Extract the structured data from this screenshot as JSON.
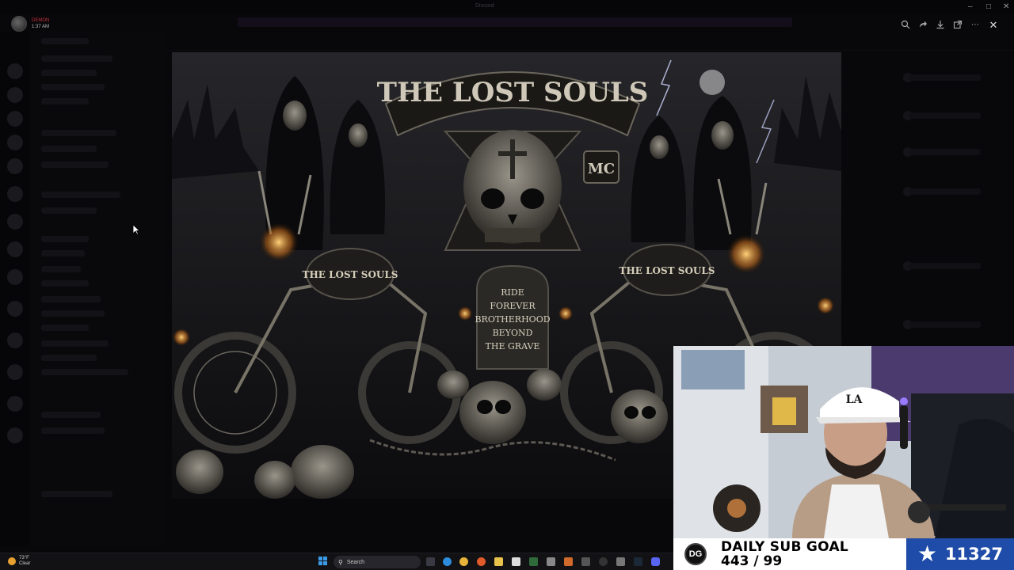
{
  "top_user": {
    "name": "DEMON",
    "time": "1:37 AM"
  },
  "window": {
    "title": "Discord"
  },
  "viewer_toolbar": {
    "icons": [
      "zoom-icon",
      "forward-icon",
      "download-icon",
      "open-external-icon",
      "more-icon",
      "close-icon"
    ]
  },
  "poster": {
    "title_text": "THE LOST SOULS",
    "badge": "MC",
    "tank_left": "THE LOST SOULS",
    "tank_right": "THE LOST SOULS",
    "tombstone_lines": [
      "RIDE",
      "FOREVER",
      "BROTHERHOOD",
      "BEYOND",
      "THE GRAVE"
    ]
  },
  "sub_goal": {
    "title": "DAILY SUB GOAL",
    "progress": "443 / 99",
    "total": "11327",
    "star": "★",
    "logo": "DG",
    "accent": "#1f4ca8"
  },
  "taskbar": {
    "weather_temp": "73°F",
    "weather_cond": "Clear",
    "search_label": "Search"
  }
}
